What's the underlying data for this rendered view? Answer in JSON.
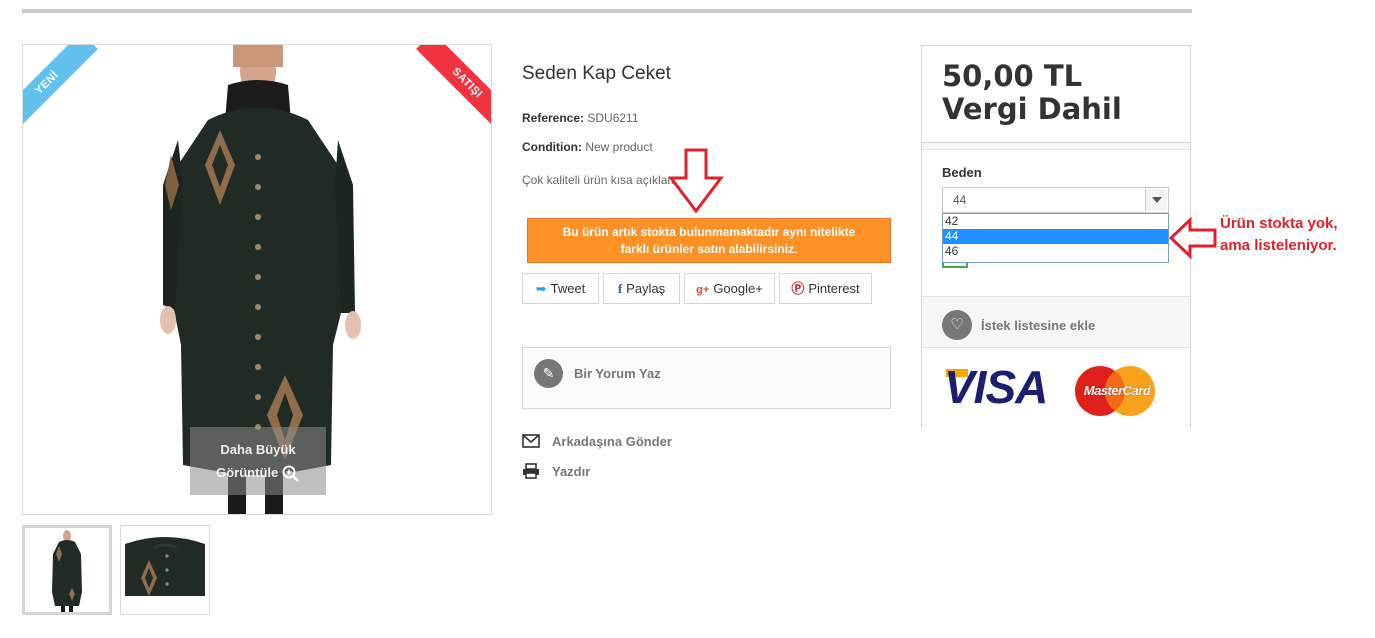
{
  "product": {
    "title": "Seden Kap Ceket",
    "reference_label": "Reference:",
    "reference_value": "SDU6211",
    "condition_label": "Condition:",
    "condition_value": "New product",
    "short_description": "Çok kaliteli ürün kısa açıklama"
  },
  "badges": {
    "new": "YENİ",
    "sale": "SATIŞI"
  },
  "image": {
    "zoom_line1": "Daha Büyük",
    "zoom_line2": "Görüntüle"
  },
  "stock_warning": {
    "line1": "Bu ürün artık stokta bulunmamaktadır aynı nitelikte",
    "line2": "farklı ürünler satın alabilirsiniz."
  },
  "social": {
    "tweet": "Tweet",
    "share": "Paylaş",
    "google": "Google+",
    "pinterest": "Pinterest"
  },
  "review": {
    "label": "Bir Yorum Yaz"
  },
  "links": {
    "send_friend": "Arkadaşına Gönder",
    "print": "Yazdır"
  },
  "buy_box": {
    "price": "50,00 TL Vergi Dahil",
    "attribute_label": "Beden",
    "selected_size": "44",
    "size_options": [
      "42",
      "44",
      "46"
    ],
    "wishlist": "İstek listesine ekle",
    "visa": "VISA",
    "mastercard": "MasterCard"
  },
  "annotation": {
    "line1": "Ürün stokta yok,",
    "line2": "ama listeleniyor."
  },
  "colors": {
    "warning_bg": "#fe9126",
    "annotation_red": "#e0202a",
    "badge_new": "#5fc2ee",
    "badge_sale": "#f13340",
    "dropdown_selected": "#1e90ff"
  }
}
